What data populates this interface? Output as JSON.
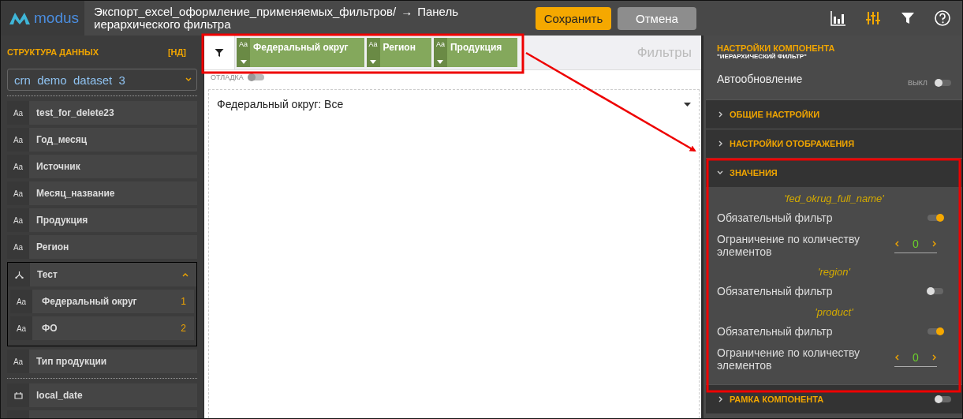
{
  "header": {
    "logo": "modus",
    "breadcrumb": [
      "Экспорт_excel_оформление_применяемых_фильтров/",
      "Панель иерархического фильтра"
    ],
    "separator": "→",
    "buttons": [
      {
        "label": "Сохранить",
        "kind": "primary"
      },
      {
        "label": "Отмена",
        "kind": "secondary"
      }
    ],
    "tools": [
      {
        "kind": "chart",
        "selected": false
      },
      {
        "kind": "settings",
        "selected": true
      },
      {
        "kind": "filter",
        "selected": false
      },
      {
        "kind": "help",
        "selected": false
      }
    ]
  },
  "sidebar": {
    "title": "СТРУКТУРА ДАННЫХ",
    "tag": "[НД]",
    "dataset": "crn  demo  dataset  3",
    "fields": [
      {
        "kind": "text",
        "badge": "Aa",
        "label": "test_for_delete23"
      },
      {
        "kind": "text",
        "badge": "Aa",
        "label": "Год_месяц"
      },
      {
        "kind": "text",
        "badge": "Aa",
        "label": "Источник"
      },
      {
        "kind": "text",
        "badge": "Aa",
        "label": "Месяц_название"
      },
      {
        "kind": "text",
        "badge": "Aa",
        "label": "Продукция"
      },
      {
        "kind": "text",
        "badge": "Aa",
        "label": "Регион"
      },
      {
        "kind": "hierarchy",
        "label": "Тест",
        "expanded": true,
        "children": [
          {
            "badge": "Aa",
            "label": "Федеральный округ",
            "order": "1"
          },
          {
            "badge": "Aa",
            "label": "ФО",
            "order": "2"
          }
        ]
      },
      {
        "kind": "text",
        "badge": "Aa",
        "label": "Тип продукции"
      },
      {
        "kind": "date",
        "label": "local_date",
        "separated": true
      },
      {
        "kind": "blank"
      }
    ]
  },
  "canvas": {
    "chips": [
      {
        "badge": "Aa",
        "label": "Федеральный округ"
      },
      {
        "badge": "Aa",
        "label": "Регион"
      },
      {
        "badge": "Aa",
        "label": "Продукция"
      }
    ],
    "caption": "Фильтры",
    "debug": {
      "label": "ОТЛАДКА",
      "on": false
    },
    "dropdown": "Федеральный округ: Все"
  },
  "settings": {
    "title": "НАСТРОЙКИ КОМПОНЕНТА",
    "subtitle": "\"ИЕРАРХИЧЕСКИЙ ФИЛЬТР\"",
    "autoupdate": {
      "label": "Автообновление",
      "state": "ВЫКЛ",
      "on": false
    },
    "sections": [
      {
        "label": "ОБЩИЕ НАСТРОЙКИ",
        "expanded": false
      },
      {
        "label": "НАСТРОЙКИ ОТОБРАЖЕНИЯ",
        "expanded": false
      },
      {
        "label": "ЗНАЧЕНИЯ",
        "expanded": true,
        "groups": [
          {
            "name": "'fed_okrug_full_name'",
            "rows": [
              {
                "kind": "toggle",
                "label": "Обязательный фильтр",
                "on": true
              },
              {
                "kind": "stepper",
                "label": "Ограничение по количеству элементов",
                "value": "0"
              }
            ]
          },
          {
            "name": "'region'",
            "rows": [
              {
                "kind": "toggle",
                "label": "Обязательный фильтр",
                "on": false
              }
            ]
          },
          {
            "name": "'product'",
            "rows": [
              {
                "kind": "toggle",
                "label": "Обязательный фильтр",
                "on": true
              },
              {
                "kind": "stepper",
                "label": "Ограничение по количеству элементов",
                "value": "0"
              }
            ]
          }
        ]
      },
      {
        "label": "РАМКА КОМПОНЕНТА",
        "expanded": false,
        "toggle": false
      }
    ]
  }
}
